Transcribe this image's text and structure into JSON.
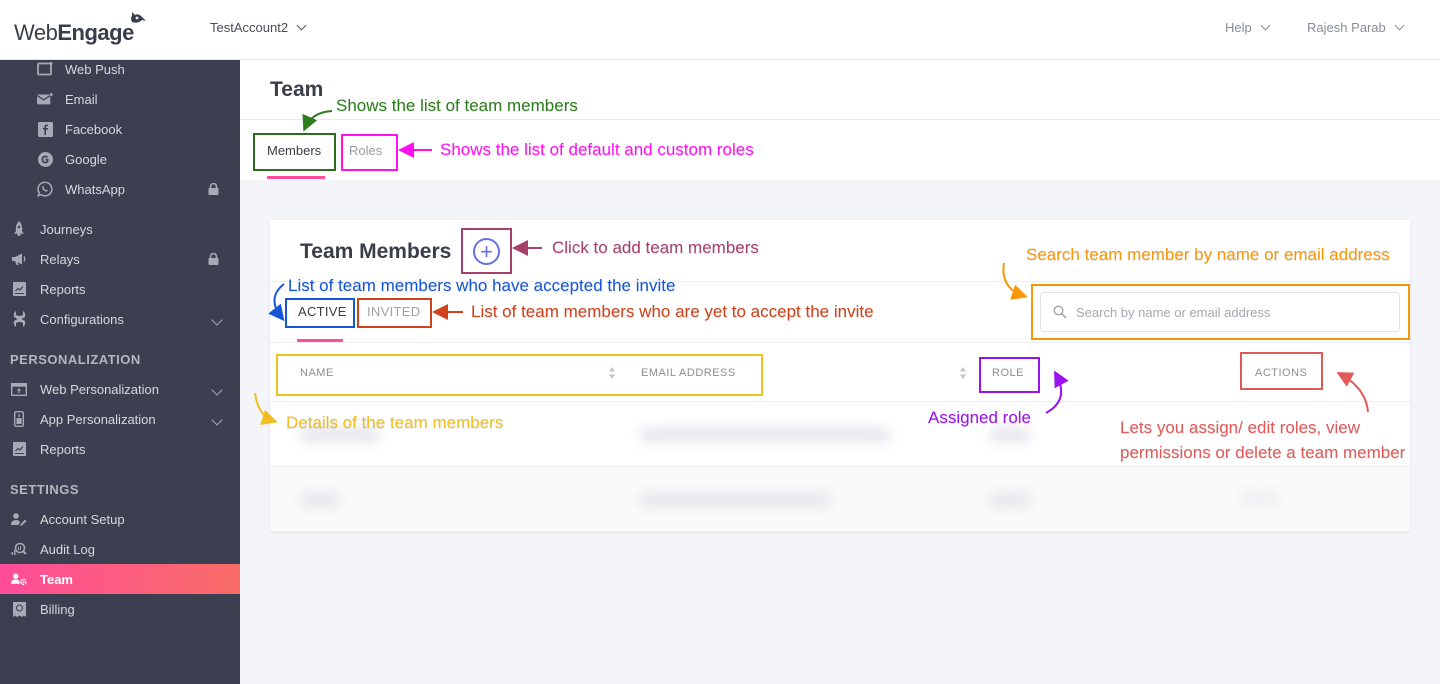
{
  "header": {
    "logo_light": "Web",
    "logo_bold": "Engage",
    "account": "TestAccount2",
    "help": "Help",
    "user": "Rajesh Parab"
  },
  "sidebar": {
    "channels": [
      {
        "label": "Web Push",
        "icon": "web-push-icon"
      },
      {
        "label": "Email",
        "icon": "email-icon"
      },
      {
        "label": "Facebook",
        "icon": "facebook-icon"
      },
      {
        "label": "Google",
        "icon": "google-icon"
      },
      {
        "label": "WhatsApp",
        "icon": "whatsapp-icon",
        "locked": true
      }
    ],
    "main_items": [
      {
        "label": "Journeys",
        "icon": "rocket-icon"
      },
      {
        "label": "Relays",
        "icon": "megaphone-icon",
        "locked": true
      },
      {
        "label": "Reports",
        "icon": "reports-icon"
      },
      {
        "label": "Configurations",
        "icon": "configurations-icon",
        "expandable": true
      }
    ],
    "personalization_title": "PERSONALIZATION",
    "personalization_items": [
      {
        "label": "Web Personalization",
        "icon": "web-personalization-icon",
        "expandable": true
      },
      {
        "label": "App Personalization",
        "icon": "app-personalization-icon",
        "expandable": true
      },
      {
        "label": "Reports",
        "icon": "reports-icon"
      }
    ],
    "settings_title": "SETTINGS",
    "settings_items": [
      {
        "label": "Account Setup",
        "icon": "account-setup-icon"
      },
      {
        "label": "Audit Log",
        "icon": "audit-log-icon"
      },
      {
        "label": "Team",
        "icon": "team-icon",
        "active": true
      },
      {
        "label": "Billing",
        "icon": "billing-icon"
      }
    ]
  },
  "page": {
    "title": "Team",
    "tabs": [
      {
        "label": "Members",
        "active": true
      },
      {
        "label": "Roles",
        "active": false
      }
    ]
  },
  "card": {
    "title": "Team Members",
    "add_icon": "+",
    "subtabs": [
      {
        "label": "ACTIVE",
        "active": true
      },
      {
        "label": "INVITED",
        "active": false
      }
    ],
    "search_placeholder": "Search by name or email address",
    "search_value": "",
    "columns": [
      "NAME",
      "EMAIL ADDRESS",
      "ROLE",
      "ACTIONS"
    ],
    "rows_note": "Row contents are blurred in the screenshot"
  },
  "annotations": {
    "members_tab": {
      "text": "Shows the list of team members",
      "color": "#2e7d1e"
    },
    "roles_tab": {
      "text": "Shows the list of default and custom roles",
      "color": "#ff10f0"
    },
    "add_member": {
      "text": "Click to add team members",
      "color": "#a8406e"
    },
    "active_tab": {
      "text": "List of team members who have accepted the invite",
      "color": "#1556d6"
    },
    "invited_tab": {
      "text": "List of team members who are yet to accept the invite",
      "color": "#d0421b"
    },
    "search": {
      "text": "Search team member by name or email address",
      "color": "#f7980b"
    },
    "details": {
      "text": "Details of the team members",
      "color": "#f0c020"
    },
    "role": {
      "text": "Assigned role",
      "color": "#9b12f0"
    },
    "actions_line1": {
      "text": "Lets you assign/ edit roles, view",
      "color": "#e05a5a"
    },
    "actions_line2": {
      "text": "permissions or delete a team member",
      "color": "#e05a5a"
    }
  },
  "colors": {
    "sidebar_bg": "#3c3f4f",
    "active_gradient_start": "#ff4d9a",
    "active_gradient_end": "#f96c67",
    "tab_underline": "#ff4d9a",
    "add_button": "#6b6fe0"
  }
}
